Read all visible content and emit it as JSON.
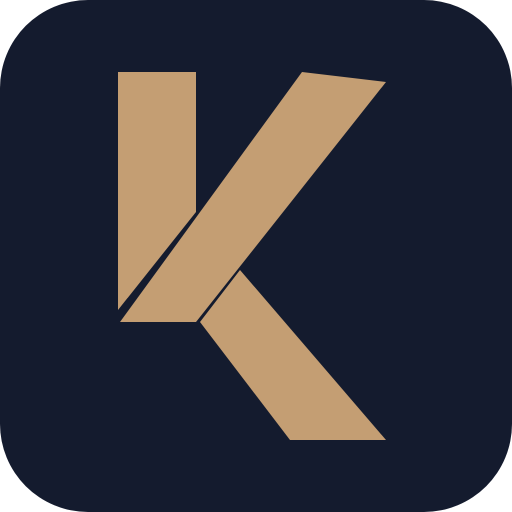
{
  "icon": {
    "name": "K",
    "background_color": "#141b2e",
    "glyph_color": "#c49e73"
  }
}
